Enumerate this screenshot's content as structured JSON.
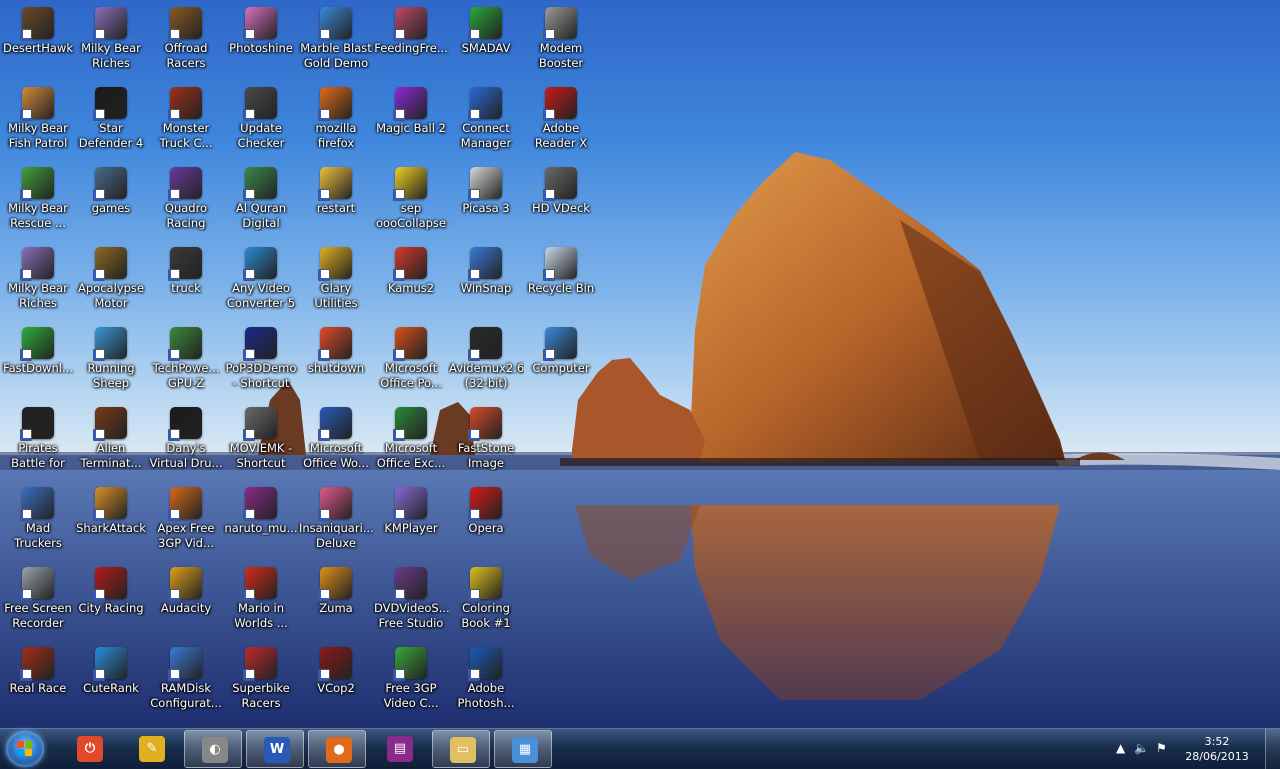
{
  "wallpaper": "haystack-rock-beach",
  "desktop_icons": [
    {
      "label": "DesertHawk",
      "icon": "desert-hawk-game-icon",
      "color": "#6b4a2a"
    },
    {
      "label": "Milky Bear Fish Patrol",
      "icon": "milky-bear-icon",
      "color": "#d28a3a"
    },
    {
      "label": "Milky Bear Rescue ...",
      "icon": "frog-icon",
      "color": "#3fa23a"
    },
    {
      "label": "Milky Bear Riches Ridi...",
      "icon": "milky-bear-icon",
      "color": "#8a6fb8"
    },
    {
      "label": "FastDownl...",
      "icon": "download-arrow-icon",
      "color": "#2fae3a"
    },
    {
      "label": "Pirates Battle for the Cari...",
      "icon": "skull-icon",
      "color": "#222222"
    },
    {
      "label": "Mad Truckers",
      "icon": "truck-icon",
      "color": "#3b6fc4"
    },
    {
      "label": "Free Screen Recorder",
      "icon": "camera-icon",
      "color": "#9aa3ad"
    },
    {
      "label": "Real Race",
      "icon": "race-game-icon",
      "color": "#a03018"
    },
    {
      "label": "Milky Bear Riches Raid...",
      "icon": "milky-bear-icon",
      "color": "#8a6fb8"
    },
    {
      "label": "Star Defender 4",
      "icon": "star-defender-icon",
      "color": "#1a1a1a"
    },
    {
      "label": "games",
      "icon": "film-folder-icon",
      "color": "#4a6a8a"
    },
    {
      "label": "Apocalypse Motor Racers",
      "icon": "car-game-icon",
      "color": "#8a6a20"
    },
    {
      "label": "Running Sheep",
      "icon": "sheep-icon",
      "color": "#3a9ad8"
    },
    {
      "label": "Alien Terminat...",
      "icon": "alien-game-icon",
      "color": "#7a3a1a"
    },
    {
      "label": "SharkAttack",
      "icon": "character-icon",
      "color": "#d8902a"
    },
    {
      "label": "City Racing",
      "icon": "city-racing-icon",
      "color": "#b81a1a"
    },
    {
      "label": "CuteRank",
      "icon": "chart-icon",
      "color": "#2a8ee0"
    },
    {
      "label": "Offroad Racers",
      "icon": "tire-icon",
      "color": "#8a5a20"
    },
    {
      "label": "Monster Truck C...",
      "icon": "monster-truck-icon",
      "color": "#a0301a"
    },
    {
      "label": "Quadro Racing",
      "icon": "quad-bike-icon",
      "color": "#6a3aa0"
    },
    {
      "label": "truck",
      "icon": "truck-icon",
      "color": "#3a3a3a"
    },
    {
      "label": "TechPowe... GPU-Z",
      "icon": "gpu-card-icon",
      "color": "#3a8a3a"
    },
    {
      "label": "Dany's Virtual Dru...",
      "icon": "dvd-icon",
      "color": "#1a1a1a"
    },
    {
      "label": "Apex Free 3GP Vid...",
      "icon": "video-converter-icon",
      "color": "#d86a1a"
    },
    {
      "label": "Audacity",
      "icon": "headphones-icon",
      "color": "#e0a01a"
    },
    {
      "label": "RAMDisk Configurat...",
      "icon": "ramdisk-icon",
      "color": "#3a7ad8"
    },
    {
      "label": "Photoshine",
      "icon": "flower-icon",
      "color": "#d870c0"
    },
    {
      "label": "Update Checker",
      "icon": "update-checker-icon",
      "color": "#4a4a4a"
    },
    {
      "label": "Al Quran Digital",
      "icon": "book-icon",
      "color": "#3a8a4a"
    },
    {
      "label": "Any Video Converter 5",
      "icon": "video-converter-icon",
      "color": "#2a8ad0"
    },
    {
      "label": "PoP3DDemo - Shortcut",
      "icon": "game-icon",
      "color": "#1a2a8a"
    },
    {
      "label": "MOVIEMK - Shortcut",
      "icon": "film-reel-icon",
      "color": "#6a6a6a"
    },
    {
      "label": "naruto_mu...",
      "icon": "winrar-icon",
      "color": "#8a2a8a"
    },
    {
      "label": "Mario in Worlds ...",
      "icon": "mario-icon",
      "color": "#d82a1a"
    },
    {
      "label": "Superbike Racers",
      "icon": "motorbike-icon",
      "color": "#c02a2a"
    },
    {
      "label": "Marble Blast Gold Demo",
      "icon": "marble-icon",
      "color": "#3a8ad8"
    },
    {
      "label": "mozilla firefox",
      "icon": "firefox-icon",
      "color": "#e06a1a"
    },
    {
      "label": "restart",
      "icon": "restart-icon",
      "color": "#f0c040"
    },
    {
      "label": "Glary Utilities",
      "icon": "utilities-icon",
      "color": "#e0b020"
    },
    {
      "label": "shutdown",
      "icon": "power-icon",
      "color": "#e04a2a"
    },
    {
      "label": "Microsoft Office Wo...",
      "icon": "word-document-icon",
      "color": "#2a5ab8"
    },
    {
      "label": "Insaniquari... Deluxe",
      "icon": "fish-icon",
      "color": "#e05a8a"
    },
    {
      "label": "Zuma",
      "icon": "zuma-icon",
      "color": "#e0901a"
    },
    {
      "label": "VCop2",
      "icon": "vcop-icon",
      "color": "#8a1a1a"
    },
    {
      "label": "FeedingFre...",
      "icon": "fish-icon",
      "color": "#c04a6a"
    },
    {
      "label": "Magic Ball 2",
      "icon": "magic-ball-icon",
      "color": "#8a2ad8"
    },
    {
      "label": "sep oooCollapse",
      "icon": "spongebob-icon",
      "color": "#f0d020"
    },
    {
      "label": "Kamus2",
      "icon": "dictionary-book-icon",
      "color": "#d83a2a"
    },
    {
      "label": "Microsoft Office Po...",
      "icon": "powerpoint-icon",
      "color": "#d8501a"
    },
    {
      "label": "Microsoft Office Exc...",
      "icon": "excel-icon",
      "color": "#2a8a3a"
    },
    {
      "label": "KMPlayer",
      "icon": "kmplayer-icon",
      "color": "#8a6ad8"
    },
    {
      "label": "DVDVideoS... Free Studio",
      "icon": "fs-studio-icon",
      "color": "#6a3a8a"
    },
    {
      "label": "Free 3GP Video C...",
      "icon": "3gp-converter-icon",
      "color": "#3aa83a"
    },
    {
      "label": "SMADAV",
      "icon": "smadav-triangle-icon",
      "color": "#2aa83a"
    },
    {
      "label": "Connect Manager",
      "icon": "3g-modem-icon",
      "color": "#2a6ad8"
    },
    {
      "label": "Picasa 3",
      "icon": "picasa-icon",
      "color": "#d8d8d8"
    },
    {
      "label": "WinSnap",
      "icon": "winsnap-icon",
      "color": "#3a7ad8"
    },
    {
      "label": "Avidemux2.6 (32-bit)",
      "icon": "clapperboard-icon",
      "color": "#2a2a2a"
    },
    {
      "label": "FastStone Image Viewer",
      "icon": "eye-icon",
      "color": "#d84a2a"
    },
    {
      "label": "Opera",
      "icon": "opera-icon",
      "color": "#d81a1a"
    },
    {
      "label": "Coloring Book #1",
      "icon": "color-wheel-icon",
      "color": "#e0c020"
    },
    {
      "label": "Adobe Photosh...",
      "icon": "photoshop-icon",
      "color": "#1a5ab8"
    },
    {
      "label": "Modem Booster",
      "icon": "modem-booster-icon",
      "color": "#9a9a9a"
    },
    {
      "label": "Adobe Reader X",
      "icon": "adobe-reader-icon",
      "color": "#c81a1a"
    },
    {
      "label": "HD VDeck",
      "icon": "speaker-icon",
      "color": "#6a6a6a"
    },
    {
      "label": "Recycle Bin",
      "icon": "recycle-bin-icon",
      "color": "#c8d8e8"
    },
    {
      "label": "Computer",
      "icon": "computer-icon",
      "color": "#3a8ad8"
    }
  ],
  "taskbar": {
    "start_label": "Start",
    "buttons": [
      {
        "name": "shutdown-pinned",
        "icon": "power-icon",
        "color": "#e04a2a",
        "text": "⏻",
        "active": false
      },
      {
        "name": "utilities-pinned",
        "icon": "utilities-icon",
        "color": "#e0b020",
        "text": "✎",
        "active": false
      },
      {
        "name": "screen-recorder-pinned",
        "icon": "recorder-icon",
        "color": "#888888",
        "text": "◐",
        "active": true
      },
      {
        "name": "word-pinned",
        "icon": "word-document-icon",
        "color": "#2a5ab8",
        "text": "W",
        "active": true
      },
      {
        "name": "firefox-pinned",
        "icon": "firefox-icon",
        "color": "#e06a1a",
        "text": "●",
        "active": true
      },
      {
        "name": "winrar-pinned",
        "icon": "winrar-icon",
        "color": "#8a2a8a",
        "text": "▤",
        "active": false
      },
      {
        "name": "explorer-pinned",
        "icon": "folder-icon",
        "color": "#e0c060",
        "text": "▭",
        "active": true
      },
      {
        "name": "control-panel-pinned",
        "icon": "control-panel-icon",
        "color": "#4a90d8",
        "text": "▦",
        "active": true
      }
    ],
    "clock_time": "3:52",
    "clock_date": "28/06/2013"
  }
}
